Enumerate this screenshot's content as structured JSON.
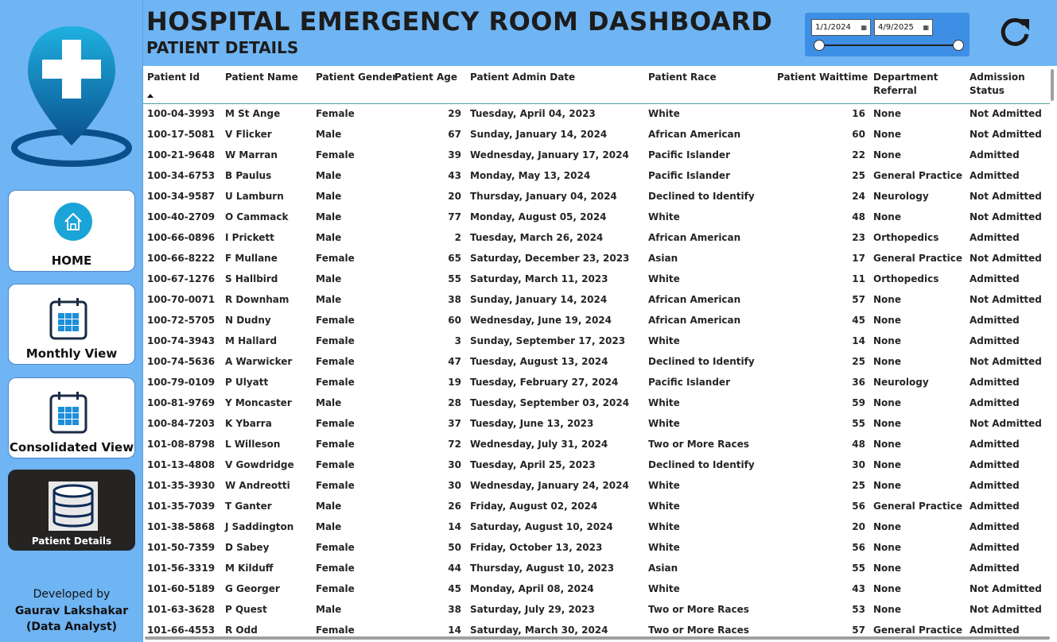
{
  "header": {
    "title": "HOSPITAL EMERGENCY ROOM DASHBOARD",
    "subtitle": "PATIENT DETAILS",
    "date_start": "1/1/2024",
    "date_end": "4/9/2025"
  },
  "sidebar": {
    "nav": [
      {
        "label": "HOME",
        "icon": "home-icon"
      },
      {
        "label": "Monthly View",
        "icon": "calendar-icon"
      },
      {
        "label": "Consolidated View",
        "icon": "calendar-icon"
      },
      {
        "label": "Patient Details",
        "icon": "database-icon",
        "active": true
      }
    ],
    "developed_by": "Developed by",
    "developer_name": "Gaurav Lakshakar",
    "developer_role": "(Data Analyst)"
  },
  "colors": {
    "accent": "#6fb4f3",
    "panel": "#3d8fe6",
    "active_nav": "#252423",
    "icon_teal": "#1ba4d8"
  },
  "table": {
    "columns": [
      "Patient Id",
      "Patient Name",
      "Patient Gender",
      "Patient Age",
      "Patient Admin Date",
      "Patient Race",
      "Patient Waittime",
      "Department Referral",
      "Admission Status"
    ],
    "rows": [
      [
        "100-04-3993",
        "M St Ange",
        "Female",
        "29",
        "Tuesday, April 04, 2023",
        "White",
        "16",
        "None",
        "Not Admitted"
      ],
      [
        "100-17-5081",
        "V Flicker",
        "Male",
        "67",
        "Sunday, January 14, 2024",
        "African American",
        "60",
        "None",
        "Not Admitted"
      ],
      [
        "100-21-9648",
        "W Marran",
        "Female",
        "39",
        "Wednesday, January 17, 2024",
        "Pacific Islander",
        "22",
        "None",
        "Admitted"
      ],
      [
        "100-34-6753",
        "B Paulus",
        "Male",
        "43",
        "Monday, May 13, 2024",
        "Pacific Islander",
        "25",
        "General Practice",
        "Admitted"
      ],
      [
        "100-34-9587",
        "U Lamburn",
        "Male",
        "20",
        "Thursday, January 04, 2024",
        "Declined to Identify",
        "24",
        "Neurology",
        "Not Admitted"
      ],
      [
        "100-40-2709",
        "O Cammack",
        "Male",
        "77",
        "Monday, August 05, 2024",
        "White",
        "48",
        "None",
        "Not Admitted"
      ],
      [
        "100-66-0896",
        "I Prickett",
        "Male",
        "2",
        "Tuesday, March 26, 2024",
        "African American",
        "23",
        "Orthopedics",
        "Admitted"
      ],
      [
        "100-66-8222",
        "F Mullane",
        "Female",
        "65",
        "Saturday, December 23, 2023",
        "Asian",
        "17",
        "General Practice",
        "Not Admitted"
      ],
      [
        "100-67-1276",
        "S Hallbird",
        "Male",
        "55",
        "Saturday, March 11, 2023",
        "White",
        "11",
        "Orthopedics",
        "Admitted"
      ],
      [
        "100-70-0071",
        "R Downham",
        "Male",
        "38",
        "Sunday, January 14, 2024",
        "African American",
        "57",
        "None",
        "Not Admitted"
      ],
      [
        "100-72-5705",
        "N Dudny",
        "Female",
        "60",
        "Wednesday, June 19, 2024",
        "African American",
        "45",
        "None",
        "Admitted"
      ],
      [
        "100-74-3943",
        "M Hallard",
        "Female",
        "3",
        "Sunday, September 17, 2023",
        "White",
        "14",
        "None",
        "Admitted"
      ],
      [
        "100-74-5636",
        "A Warwicker",
        "Female",
        "47",
        "Tuesday, August 13, 2024",
        "Declined to Identify",
        "25",
        "None",
        "Not Admitted"
      ],
      [
        "100-79-0109",
        "P Ulyatt",
        "Female",
        "19",
        "Tuesday, February 27, 2024",
        "Pacific Islander",
        "36",
        "Neurology",
        "Admitted"
      ],
      [
        "100-81-9769",
        "Y Moncaster",
        "Male",
        "28",
        "Tuesday, September 03, 2024",
        "White",
        "59",
        "None",
        "Admitted"
      ],
      [
        "100-84-7203",
        "K Ybarra",
        "Female",
        "37",
        "Tuesday, June 13, 2023",
        "White",
        "55",
        "None",
        "Not Admitted"
      ],
      [
        "101-08-8798",
        "L Willeson",
        "Female",
        "72",
        "Wednesday, July 31, 2024",
        "Two or More Races",
        "48",
        "None",
        "Admitted"
      ],
      [
        "101-13-4808",
        "V Gowdridge",
        "Female",
        "30",
        "Tuesday, April 25, 2023",
        "Declined to Identify",
        "30",
        "None",
        "Admitted"
      ],
      [
        "101-35-3930",
        "W Andreotti",
        "Female",
        "30",
        "Wednesday, January 24, 2024",
        "White",
        "25",
        "None",
        "Admitted"
      ],
      [
        "101-35-7039",
        "T Ganter",
        "Male",
        "26",
        "Friday, August 02, 2024",
        "White",
        "56",
        "General Practice",
        "Admitted"
      ],
      [
        "101-38-5868",
        "J Saddington",
        "Male",
        "14",
        "Saturday, August 10, 2024",
        "White",
        "20",
        "None",
        "Admitted"
      ],
      [
        "101-50-7359",
        "D Sabey",
        "Female",
        "50",
        "Friday, October 13, 2023",
        "White",
        "56",
        "None",
        "Admitted"
      ],
      [
        "101-56-3319",
        "M Kilduff",
        "Female",
        "44",
        "Thursday, August 10, 2023",
        "Asian",
        "55",
        "None",
        "Admitted"
      ],
      [
        "101-60-5189",
        "G Georger",
        "Female",
        "45",
        "Monday, April 08, 2024",
        "White",
        "43",
        "None",
        "Not Admitted"
      ],
      [
        "101-63-3628",
        "P Quest",
        "Male",
        "38",
        "Saturday, July 29, 2023",
        "Two or More Races",
        "53",
        "None",
        "Not Admitted"
      ],
      [
        "101-66-4553",
        "R Odd",
        "Female",
        "14",
        "Saturday, March 30, 2024",
        "Two or More Races",
        "57",
        "General Practice",
        "Admitted"
      ]
    ]
  }
}
